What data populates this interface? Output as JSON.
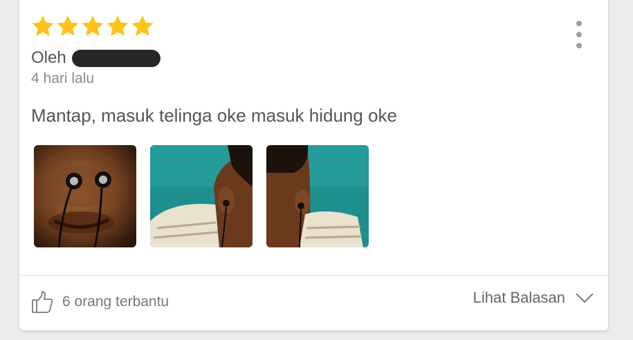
{
  "review": {
    "rating": 5,
    "rating_max": 5,
    "star_color": "#FFC21A",
    "author_prefix": "Oleh",
    "author_name_redacted": true,
    "time_ago": "4 hari lalu",
    "text": "Mantap, masuk telinga oke masuk hidung oke",
    "photos": [
      {
        "subject": "face-close-up-earphones-in-nose"
      },
      {
        "subject": "person-wearing-earphone-side-view"
      },
      {
        "subject": "person-wearing-earphone-back-view"
      }
    ],
    "helpful_label": "6 orang terbantu",
    "helpful_count": 6,
    "view_replies_label": "Lihat Balasan"
  },
  "icons": {
    "menu": "more-vertical-icon",
    "helpful": "thumbs-up-icon",
    "expand": "chevron-down-icon"
  }
}
